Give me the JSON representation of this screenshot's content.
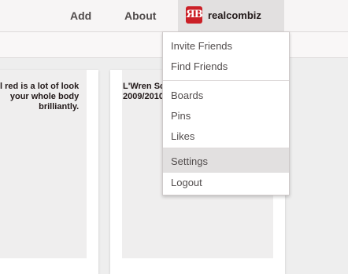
{
  "nav": {
    "add_label": "Add",
    "about_label": "About",
    "logo_text": "ЯB",
    "username": "realcombiz"
  },
  "pins": [
    {
      "text": "l red is a lot of look\n your whole body\n brilliantly."
    },
    {
      "text": "L'Wren Sc\n2009/2010"
    }
  ],
  "menu": {
    "groups": [
      [
        "Invite Friends",
        "Find Friends"
      ],
      [
        "Boards",
        "Pins",
        "Likes"
      ],
      [
        "Settings",
        "Logout"
      ]
    ],
    "active_item": "Settings"
  },
  "colors": {
    "brand": "#cb2027",
    "active_bg": "#e2e0e0"
  }
}
